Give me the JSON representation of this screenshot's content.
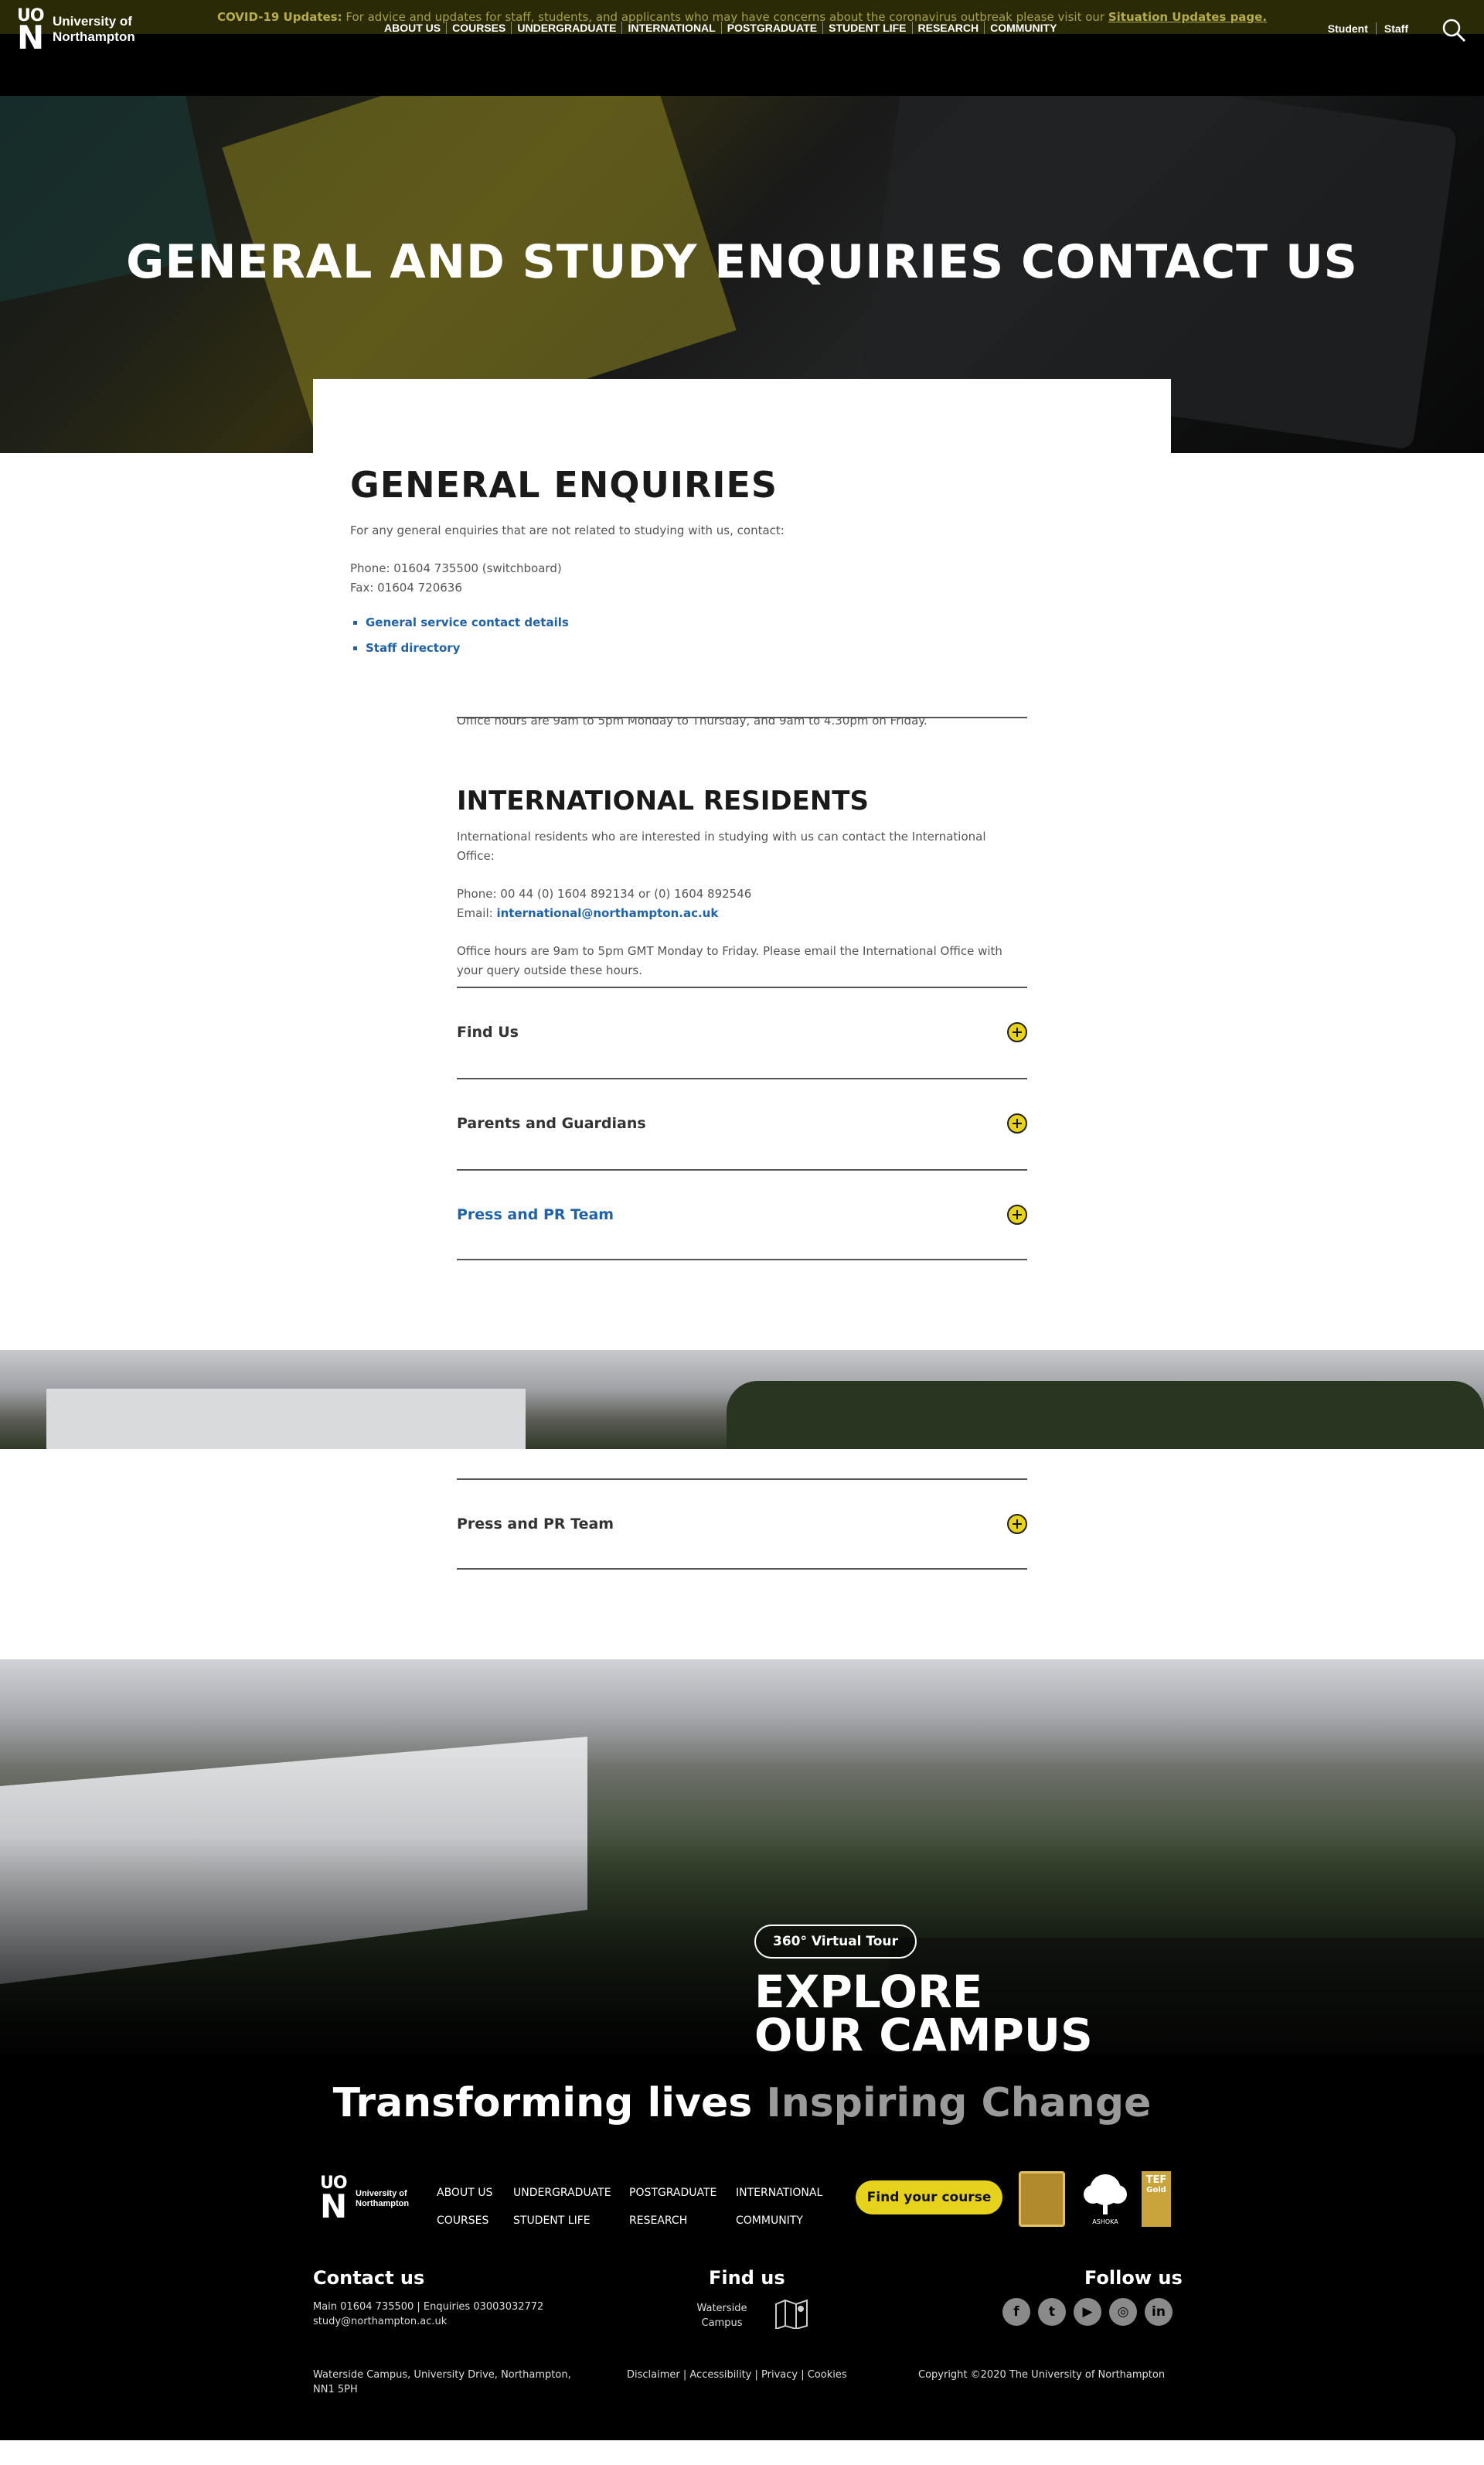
{
  "covid_banner": {
    "label": "COVID-19 Updates:",
    "text": "For advice and updates for staff, students, and applicants who may have concerns about the coronavirus outbreak please visit our",
    "link": "Situation Updates page."
  },
  "header": {
    "logo_line1": "University of",
    "logo_line2": "Northampton",
    "logo_mark_top": "UO",
    "logo_mark_bottom": "N",
    "nav": [
      "ABOUT US",
      "COURSES",
      "UNDERGRADUATE",
      "INTERNATIONAL",
      "POSTGRADUATE",
      "STUDENT LIFE",
      "RESEARCH",
      "COMMUNITY"
    ],
    "user_links": [
      "Student",
      "Staff"
    ]
  },
  "hero": {
    "title": "GENERAL AND STUDY ENQUIRIES CONTACT US"
  },
  "general": {
    "heading": "GENERAL ENQUIRIES",
    "intro": "For any general enquiries that are not related to studying with us, contact:",
    "phone": "Phone: 01604 735500 (switchboard)",
    "fax": "Fax: 01604 720636",
    "links": [
      "General service contact details",
      "Staff directory"
    ]
  },
  "office_hours_cut": "Office hours are 9am to 5pm Monday to Thursday, and 9am to 4.30pm on Friday.",
  "international": {
    "heading": "INTERNATIONAL RESIDENTS",
    "intro": "International residents who are interested in studying with us can contact the International Office:",
    "phone": "Phone: 00 44 (0) 1604 892134 or (0) 1604 892546",
    "email_label": "Email:",
    "email": "international@northampton.ac.uk",
    "hours_line1": "Office hours are 9am to 5pm GMT Monday to Friday. Please email the International Office with",
    "hours_line2": "your query outside these hours."
  },
  "accordion": [
    "Find Us",
    "Parents and Guardians",
    "Press and PR Team"
  ],
  "accordion_repeat": "Press and PR Team",
  "campus": {
    "tour_button": "360° Virtual Tour",
    "explore_line1": "EXPLORE",
    "explore_line2": "OUR CAMPUS"
  },
  "footer": {
    "tagline_white": "Transforming lives",
    "tagline_grey": "Inspiring Change",
    "nav_col1": [
      "ABOUT US",
      "COURSES"
    ],
    "nav_col2": [
      "UNDERGRADUATE",
      "STUDENT LIFE"
    ],
    "nav_col3": [
      "POSTGRADUATE",
      "RESEARCH"
    ],
    "nav_col4": [
      "INTERNATIONAL",
      "COMMUNITY"
    ],
    "find_course": "Find your course",
    "badge_ashoka": "ASHOKA",
    "badge_tef": "TEF",
    "badge_tef_level": "Gold",
    "contact_heading": "Contact us",
    "contact_line1": "Main 01604 735500 | Enquiries 03003032772",
    "contact_line2": "study@northampton.ac.uk",
    "find_heading": "Find us",
    "find_line1": "Waterside",
    "find_line2": "Campus",
    "follow_heading": "Follow us",
    "social": [
      "f",
      "t",
      "▶",
      "◎",
      "in"
    ],
    "address_line1": "Waterside Campus, University Drive, Northampton,",
    "address_line2": "NN1 5PH",
    "legal_links": "Disclaimer | Accessibility | Privacy | Cookies",
    "copyright": "Copyright ©2020 The University of Northampton"
  }
}
